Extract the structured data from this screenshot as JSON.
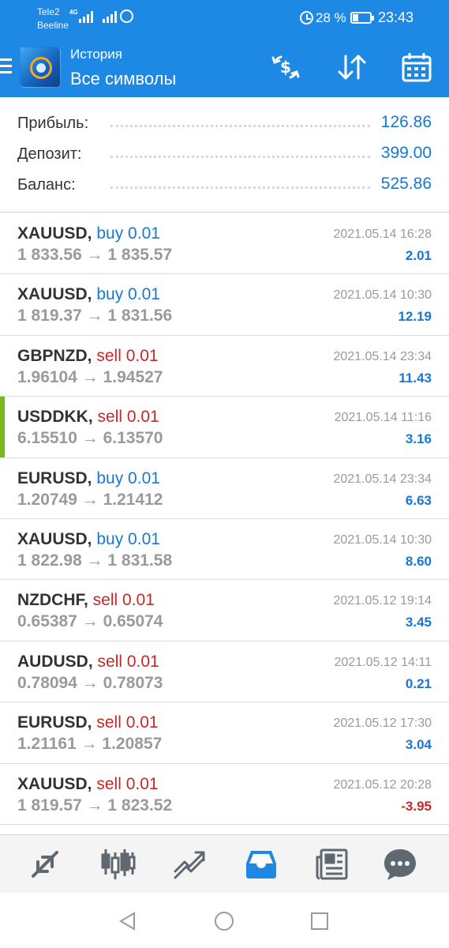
{
  "status_bar": {
    "carrier1": "Tele2",
    "carrier2": "Beeline",
    "network": "4G",
    "battery_pct": "28 %",
    "time": "23:43"
  },
  "app_bar": {
    "title": "История",
    "subtitle": "Все символы",
    "icons": [
      "menu-icon",
      "app-logo",
      "currency-exchange-icon",
      "sort-icon",
      "calendar-icon"
    ]
  },
  "summary": [
    {
      "label": "Прибыль:",
      "value": "126.86"
    },
    {
      "label": "Депозит:",
      "value": "399.00"
    },
    {
      "label": "Баланс:",
      "value": "525.86"
    }
  ],
  "trades": [
    {
      "symbol": "XAUUSD,",
      "side": "buy 0.01",
      "prices": "1 833.56 → 1 835.57",
      "date": "2021.05.14 16:28",
      "profit": "2.01"
    },
    {
      "symbol": "XAUUSD,",
      "side": "buy 0.01",
      "prices": "1 819.37 → 1 831.56",
      "date": "2021.05.14 10:30",
      "profit": "12.19"
    },
    {
      "symbol": "GBPNZD,",
      "side": "sell 0.01",
      "prices": "1.96104 → 1.94527",
      "date": "2021.05.14 23:34",
      "profit": "11.43"
    },
    {
      "symbol": "USDDKK,",
      "side": "sell 0.01",
      "prices": "6.15510 → 6.13570",
      "date": "2021.05.14 11:16",
      "profit": "3.16"
    },
    {
      "symbol": "EURUSD,",
      "side": "buy 0.01",
      "prices": "1.20749 → 1.21412",
      "date": "2021.05.14 23:34",
      "profit": "6.63"
    },
    {
      "symbol": "XAUUSD,",
      "side": "buy 0.01",
      "prices": "1 822.98 → 1 831.58",
      "date": "2021.05.14 10:30",
      "profit": "8.60"
    },
    {
      "symbol": "NZDCHF,",
      "side": "sell 0.01",
      "prices": "0.65387 → 0.65074",
      "date": "2021.05.12 19:14",
      "profit": "3.45"
    },
    {
      "symbol": "AUDUSD,",
      "side": "sell 0.01",
      "prices": "0.78094 → 0.78073",
      "date": "2021.05.12 14:11",
      "profit": "0.21"
    },
    {
      "symbol": "EURUSD,",
      "side": "sell 0.01",
      "prices": "1.21161 → 1.20857",
      "date": "2021.05.12 17:30",
      "profit": "3.04"
    },
    {
      "symbol": "XAUUSD,",
      "side": "sell 0.01",
      "prices": "1 819.57 → 1 823.52",
      "date": "2021.05.12 20:28",
      "profit": "-3.95"
    }
  ],
  "bottom_nav": [
    "quotes-icon",
    "chart-icon",
    "trade-icon",
    "history-icon",
    "news-icon",
    "chat-icon"
  ],
  "system_nav": [
    "back-icon",
    "home-icon",
    "recents-icon"
  ],
  "colors": {
    "accent": "#1e88e5",
    "buy": "#1877d4",
    "sell": "#c62828",
    "active_row_marker": "#7ab620"
  }
}
